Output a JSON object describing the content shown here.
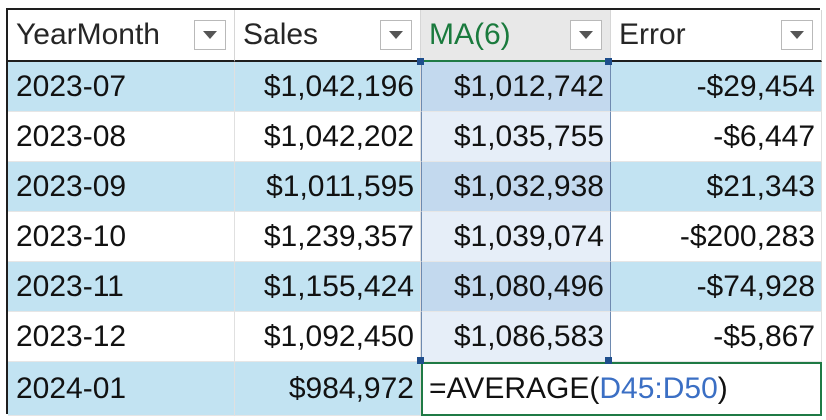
{
  "headers": {
    "col1": "YearMonth",
    "col2": "Sales",
    "col3": "MA(6)",
    "col4": "Error"
  },
  "rows": [
    {
      "ym": "2023-07",
      "sales": "$1,042,196",
      "ma": "$1,012,742",
      "err": "-$29,454"
    },
    {
      "ym": "2023-08",
      "sales": "$1,042,202",
      "ma": "$1,035,755",
      "err": "-$6,447"
    },
    {
      "ym": "2023-09",
      "sales": "$1,011,595",
      "ma": "$1,032,938",
      "err": "$21,343"
    },
    {
      "ym": "2023-10",
      "sales": "$1,239,357",
      "ma": "$1,039,074",
      "err": "-$200,283"
    },
    {
      "ym": "2023-11",
      "sales": "$1,155,424",
      "ma": "$1,080,496",
      "err": "-$74,928"
    },
    {
      "ym": "2023-12",
      "sales": "$1,092,450",
      "ma": "$1,086,583",
      "err": "-$5,867"
    }
  ],
  "last_row": {
    "ym": "2024-01",
    "sales": "$984,972",
    "formula_prefix": "=AVERAGE(",
    "formula_ref": "D45:D50",
    "formula_suffix": ")"
  },
  "colors": {
    "band": "#c2e3f2",
    "active_header_text": "#1a7a3d",
    "formula_ref": "#3b6fc4",
    "edit_border": "#1f7a45"
  }
}
